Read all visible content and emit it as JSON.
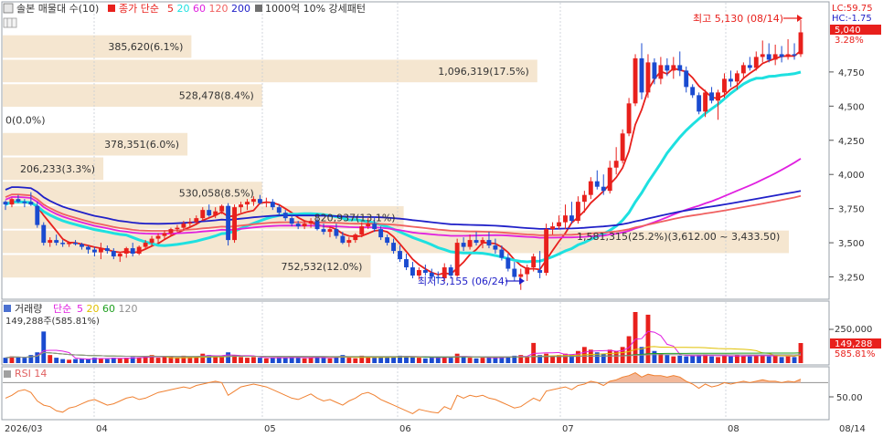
{
  "legend": {
    "top_title": "솔본 매물대 수(10)",
    "ma_prefix": "종가 단순",
    "ma_periods": [
      "5",
      "20",
      "60",
      "120",
      "200"
    ],
    "ma_colors": [
      "#e8201c",
      "#1ee0e0",
      "#e020e0",
      "#f06060",
      "#2020c8"
    ],
    "pattern": "1000억 10% 강세패턴",
    "volume_title": "거래량",
    "volume_ma_prefix": "단순",
    "volume_ma_periods": [
      "5",
      "20",
      "60",
      "120"
    ],
    "volume_ma_colors": [
      "#e020e0",
      "#e0c000",
      "#20a020",
      "#909090"
    ],
    "volume_value": "149,288주(585.81%)",
    "rsi_title": "RSI 14"
  },
  "price_axis": {
    "ticks": [
      "4,750",
      "4,500",
      "4,250",
      "4,000",
      "3,750",
      "3,500",
      "3,250"
    ],
    "lc": "LC:59.75",
    "hc": "HC:-1.75",
    "current": "5,040",
    "current_change": "3.28%"
  },
  "volume_axis": {
    "tick": "250,000",
    "current": "149,288",
    "current_pct": "585.81%"
  },
  "rsi_axis": {
    "tick": "50.00"
  },
  "date_axis": [
    "2026/03",
    "04",
    "05",
    "06",
    "07",
    "08",
    "08/14"
  ],
  "annotations": {
    "high": "최고 5,130 (08/14)",
    "low": "최저 3,155 (06/24)",
    "range_band": "1,581,315(25.2%)(3,612.00 ~ 3,433.50)"
  },
  "chart_data": {
    "type": "candlestick",
    "y_range": [
      3100,
      5250
    ],
    "volume_profile": [
      {
        "price_level": 5125,
        "label": "",
        "fraction": 0
      },
      {
        "price_level": 4936,
        "label": "385,620(6.1%)",
        "fraction": 0.24
      },
      {
        "price_level": 4757,
        "label": "1,096,319(17.5%)",
        "fraction": 0.68
      },
      {
        "price_level": 4578,
        "label": "528,478(8.4%)",
        "fraction": 0.33
      },
      {
        "price_level": 4400,
        "label": "0(0.0%)",
        "fraction": 0
      },
      {
        "price_level": 4221,
        "label": "378,351(6.0%)",
        "fraction": 0.235
      },
      {
        "price_level": 4042,
        "label": "206,233(3.3%)",
        "fraction": 0.128
      },
      {
        "price_level": 3864,
        "label": "530,058(8.5%)",
        "fraction": 0.33
      },
      {
        "price_level": 3685,
        "label": "820,937(13.1%)",
        "fraction": 0.51
      },
      {
        "price_level": 3507,
        "label": "",
        "fraction": 1.0
      },
      {
        "price_level": 3328,
        "label": "752,532(12.0%)",
        "fraction": 0.468
      }
    ],
    "candles": [
      [
        3800,
        3810,
        3740,
        3780,
        40000
      ],
      [
        3780,
        3830,
        3760,
        3820,
        50000
      ],
      [
        3820,
        3850,
        3790,
        3800,
        45000
      ],
      [
        3800,
        3820,
        3760,
        3790,
        40000
      ],
      [
        3800,
        3870,
        3770,
        3780,
        60000
      ],
      [
        3770,
        3800,
        3610,
        3630,
        80000
      ],
      [
        3630,
        3650,
        3480,
        3500,
        235000
      ],
      [
        3500,
        3540,
        3470,
        3520,
        60000
      ],
      [
        3520,
        3560,
        3480,
        3500,
        40000
      ],
      [
        3500,
        3520,
        3470,
        3490,
        30000
      ],
      [
        3490,
        3510,
        3470,
        3500,
        25000
      ],
      [
        3500,
        3520,
        3480,
        3490,
        30000
      ],
      [
        3490,
        3500,
        3450,
        3470,
        35000
      ],
      [
        3470,
        3480,
        3420,
        3450,
        30000
      ],
      [
        3450,
        3470,
        3400,
        3430,
        40000
      ],
      [
        3430,
        3500,
        3380,
        3460,
        35000
      ],
      [
        3460,
        3480,
        3420,
        3440,
        30000
      ],
      [
        3440,
        3460,
        3380,
        3400,
        40000
      ],
      [
        3400,
        3430,
        3360,
        3420,
        35000
      ],
      [
        3420,
        3470,
        3390,
        3460,
        40000
      ],
      [
        3460,
        3500,
        3400,
        3420,
        45000
      ],
      [
        3420,
        3480,
        3410,
        3470,
        40000
      ],
      [
        3470,
        3520,
        3460,
        3500,
        50000
      ],
      [
        3500,
        3550,
        3480,
        3530,
        60000
      ],
      [
        3530,
        3570,
        3500,
        3550,
        40000
      ],
      [
        3550,
        3590,
        3520,
        3570,
        45000
      ],
      [
        3570,
        3610,
        3550,
        3600,
        50000
      ],
      [
        3600,
        3630,
        3580,
        3610,
        40000
      ],
      [
        3610,
        3660,
        3590,
        3640,
        55000
      ],
      [
        3640,
        3680,
        3620,
        3650,
        45000
      ],
      [
        3650,
        3700,
        3630,
        3680,
        50000
      ],
      [
        3680,
        3760,
        3660,
        3740,
        70000
      ],
      [
        3740,
        3780,
        3690,
        3700,
        60000
      ],
      [
        3700,
        3760,
        3680,
        3730,
        45000
      ],
      [
        3730,
        3780,
        3710,
        3770,
        50000
      ],
      [
        3770,
        3790,
        3480,
        3520,
        80000
      ],
      [
        3520,
        3780,
        3500,
        3760,
        60000
      ],
      [
        3760,
        3800,
        3720,
        3780,
        45000
      ],
      [
        3780,
        3820,
        3740,
        3800,
        40000
      ],
      [
        3800,
        3840,
        3770,
        3820,
        45000
      ],
      [
        3820,
        3850,
        3780,
        3790,
        40000
      ],
      [
        3790,
        3830,
        3760,
        3800,
        35000
      ],
      [
        3800,
        3820,
        3740,
        3760,
        40000
      ],
      [
        3760,
        3780,
        3700,
        3720,
        45000
      ],
      [
        3720,
        3740,
        3660,
        3680,
        40000
      ],
      [
        3680,
        3700,
        3620,
        3640,
        45000
      ],
      [
        3640,
        3660,
        3600,
        3620,
        40000
      ],
      [
        3620,
        3660,
        3600,
        3640,
        35000
      ],
      [
        3640,
        3680,
        3610,
        3660,
        40000
      ],
      [
        3660,
        3680,
        3590,
        3600,
        50000
      ],
      [
        3600,
        3640,
        3560,
        3580,
        40000
      ],
      [
        3580,
        3620,
        3540,
        3600,
        35000
      ],
      [
        3600,
        3640,
        3530,
        3550,
        45000
      ],
      [
        3550,
        3580,
        3490,
        3500,
        60000
      ],
      [
        3500,
        3540,
        3470,
        3520,
        40000
      ],
      [
        3520,
        3570,
        3500,
        3560,
        35000
      ],
      [
        3560,
        3650,
        3540,
        3620,
        55000
      ],
      [
        3620,
        3680,
        3600,
        3640,
        45000
      ],
      [
        3640,
        3690,
        3580,
        3600,
        40000
      ],
      [
        3600,
        3620,
        3520,
        3540,
        50000
      ],
      [
        3540,
        3560,
        3480,
        3500,
        45000
      ],
      [
        3500,
        3530,
        3420,
        3440,
        50000
      ],
      [
        3440,
        3480,
        3360,
        3380,
        55000
      ],
      [
        3380,
        3420,
        3300,
        3320,
        50000
      ],
      [
        3320,
        3360,
        3240,
        3260,
        45000
      ],
      [
        3260,
        3320,
        3230,
        3300,
        40000
      ],
      [
        3300,
        3340,
        3260,
        3280,
        35000
      ],
      [
        3280,
        3310,
        3230,
        3250,
        40000
      ],
      [
        3250,
        3290,
        3200,
        3240,
        45000
      ],
      [
        3240,
        3350,
        3220,
        3320,
        50000
      ],
      [
        3320,
        3340,
        3240,
        3260,
        40000
      ],
      [
        3260,
        3530,
        3250,
        3500,
        70000
      ],
      [
        3500,
        3540,
        3440,
        3470,
        45000
      ],
      [
        3470,
        3560,
        3450,
        3520,
        40000
      ],
      [
        3520,
        3580,
        3480,
        3500,
        35000
      ],
      [
        3500,
        3540,
        3460,
        3520,
        40000
      ],
      [
        3520,
        3580,
        3460,
        3480,
        45000
      ],
      [
        3480,
        3530,
        3420,
        3450,
        40000
      ],
      [
        3450,
        3480,
        3370,
        3390,
        45000
      ],
      [
        3390,
        3420,
        3290,
        3310,
        50000
      ],
      [
        3310,
        3360,
        3220,
        3250,
        55000
      ],
      [
        3250,
        3310,
        3155,
        3270,
        60000
      ],
      [
        3270,
        3340,
        3220,
        3320,
        45000
      ],
      [
        3320,
        3420,
        3290,
        3400,
        150000
      ],
      [
        3300,
        3440,
        3240,
        3280,
        60000
      ],
      [
        3280,
        3640,
        3260,
        3600,
        70000
      ],
      [
        3600,
        3650,
        3560,
        3620,
        55000
      ],
      [
        3620,
        3700,
        3600,
        3650,
        60000
      ],
      [
        3650,
        3780,
        3600,
        3700,
        70000
      ],
      [
        3700,
        3800,
        3640,
        3660,
        65000
      ],
      [
        3660,
        3840,
        3640,
        3800,
        90000
      ],
      [
        3800,
        3880,
        3720,
        3850,
        120000
      ],
      [
        3850,
        3980,
        3820,
        3950,
        100000
      ],
      [
        3950,
        4030,
        3890,
        3910,
        80000
      ],
      [
        3910,
        4000,
        3850,
        3880,
        70000
      ],
      [
        3880,
        4100,
        3860,
        4050,
        100000
      ],
      [
        4050,
        4200,
        4000,
        4100,
        90000
      ],
      [
        4100,
        4330,
        4080,
        4300,
        120000
      ],
      [
        4300,
        4560,
        4280,
        4520,
        200000
      ],
      [
        4520,
        4880,
        4500,
        4850,
        380000
      ],
      [
        4850,
        4960,
        4550,
        4600,
        120000
      ],
      [
        4600,
        4880,
        4560,
        4820,
        360000
      ],
      [
        4820,
        4850,
        4660,
        4700,
        90000
      ],
      [
        4700,
        4860,
        4660,
        4800,
        70000
      ],
      [
        4800,
        4850,
        4720,
        4760,
        60000
      ],
      [
        4760,
        4860,
        4700,
        4800,
        50000
      ],
      [
        4800,
        4900,
        4720,
        4760,
        55000
      ],
      [
        4760,
        4790,
        4600,
        4640,
        50000
      ],
      [
        4640,
        4660,
        4560,
        4580,
        55000
      ],
      [
        4580,
        4600,
        4440,
        4460,
        60000
      ],
      [
        4460,
        4620,
        4420,
        4600,
        65000
      ],
      [
        4600,
        4640,
        4520,
        4540,
        50000
      ],
      [
        4540,
        4620,
        4400,
        4600,
        45000
      ],
      [
        4600,
        4740,
        4560,
        4700,
        55000
      ],
      [
        4700,
        4760,
        4640,
        4680,
        50000
      ],
      [
        4680,
        4760,
        4620,
        4740,
        60000
      ],
      [
        4740,
        4820,
        4700,
        4800,
        55000
      ],
      [
        4800,
        4860,
        4760,
        4780,
        50000
      ],
      [
        4780,
        4900,
        4760,
        4860,
        60000
      ],
      [
        4860,
        4980,
        4820,
        4880,
        55000
      ],
      [
        4880,
        4960,
        4820,
        4840,
        50000
      ],
      [
        4840,
        4950,
        4800,
        4880,
        60000
      ],
      [
        4880,
        4940,
        4820,
        4860,
        45000
      ],
      [
        4860,
        4990,
        4840,
        4880,
        50000
      ],
      [
        4880,
        4960,
        4840,
        4870,
        45000
      ],
      [
        4880,
        5130,
        4860,
        5040,
        149288
      ]
    ],
    "rsi_14": [
      48,
      52,
      58,
      60,
      56,
      44,
      38,
      36,
      30,
      28,
      34,
      36,
      40,
      44,
      46,
      42,
      38,
      40,
      44,
      48,
      50,
      46,
      48,
      52,
      56,
      58,
      60,
      62,
      64,
      62,
      66,
      68,
      70,
      72,
      70,
      52,
      58,
      64,
      66,
      68,
      66,
      64,
      60,
      56,
      52,
      48,
      46,
      50,
      54,
      48,
      44,
      46,
      42,
      38,
      44,
      48,
      54,
      56,
      52,
      46,
      42,
      38,
      34,
      30,
      26,
      32,
      30,
      28,
      27,
      36,
      32,
      52,
      48,
      52,
      50,
      52,
      48,
      46,
      42,
      38,
      34,
      36,
      42,
      48,
      44,
      58,
      60,
      62,
      64,
      60,
      66,
      68,
      72,
      70,
      66,
      72,
      74,
      78,
      80,
      84,
      78,
      82,
      80,
      80,
      78,
      80,
      78,
      72,
      68,
      62,
      68,
      64,
      66,
      70,
      68,
      70,
      72,
      70,
      72,
      74,
      72,
      72,
      70,
      72,
      71,
      75
    ],
    "ma_periods": [
      5,
      20,
      60,
      120,
      200
    ]
  }
}
